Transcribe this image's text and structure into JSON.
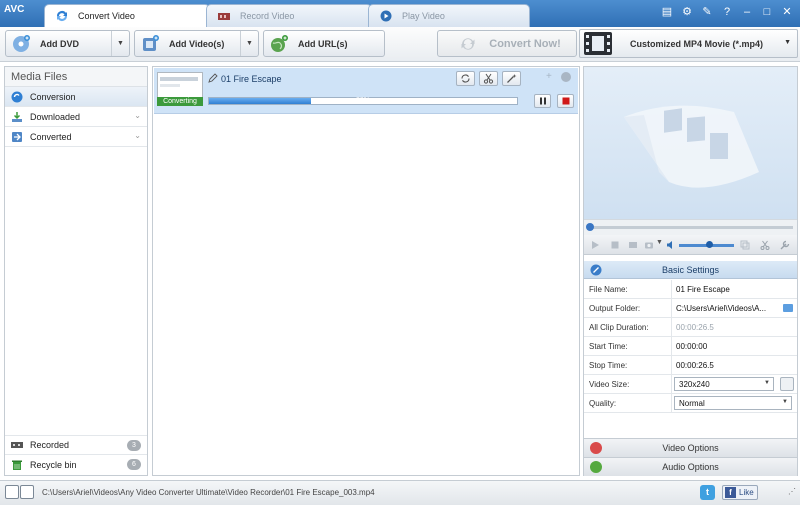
{
  "app": {
    "logo": "AVC"
  },
  "tabs": [
    {
      "label": "Convert Video",
      "active": true
    },
    {
      "label": "Record Video",
      "active": false
    },
    {
      "label": "Play Video",
      "active": false
    }
  ],
  "window_buttons": [
    "menu-icon",
    "gear-icon",
    "wrench-icon",
    "help-icon",
    "minimize-icon",
    "maximize-icon",
    "close-icon"
  ],
  "toolbar": {
    "add_dvd": "Add DVD",
    "add_videos": "Add Video(s)",
    "add_urls": "Add URL(s)",
    "convert_now": "Convert Now!",
    "profile": "Customized MP4 Movie (*.mp4)"
  },
  "sidebar": {
    "title": "Media Files",
    "items": [
      {
        "label": "Conversion",
        "selected": true
      },
      {
        "label": "Downloaded"
      },
      {
        "label": "Converted"
      }
    ],
    "bottom": [
      {
        "label": "Recorded",
        "count": "3"
      },
      {
        "label": "Recycle bin",
        "count": "6"
      }
    ]
  },
  "task": {
    "title": "01 Fire Escape",
    "status": "Converting",
    "progress_text": "33%",
    "progress": 0.33
  },
  "basic_settings": {
    "header": "Basic Settings",
    "rows": [
      {
        "label": "File Name:",
        "value": "01 Fire Escape"
      },
      {
        "label": "Output Folder:",
        "value": "C:\\Users\\Ariel\\Videos\\A..."
      },
      {
        "label": "All Clip Duration:",
        "value": "00:00:26.5"
      },
      {
        "label": "Start Time:",
        "value": "00:00:00"
      },
      {
        "label": "Stop Time:",
        "value": "00:00:26.5"
      },
      {
        "label": "Video Size:",
        "value": "320x240"
      },
      {
        "label": "Quality:",
        "value": "Normal"
      }
    ]
  },
  "video_options": "Video Options",
  "audio_options": "Audio Options",
  "status": {
    "path": "C:\\Users\\Ariel\\Videos\\Any Video Converter Ultimate\\Video Recorder\\01 Fire Escape_003.mp4",
    "like": "Like"
  },
  "colors": {
    "accent": "#2f6fb5",
    "progress": "#2f7fd3",
    "converting": "#3c9a3c"
  }
}
